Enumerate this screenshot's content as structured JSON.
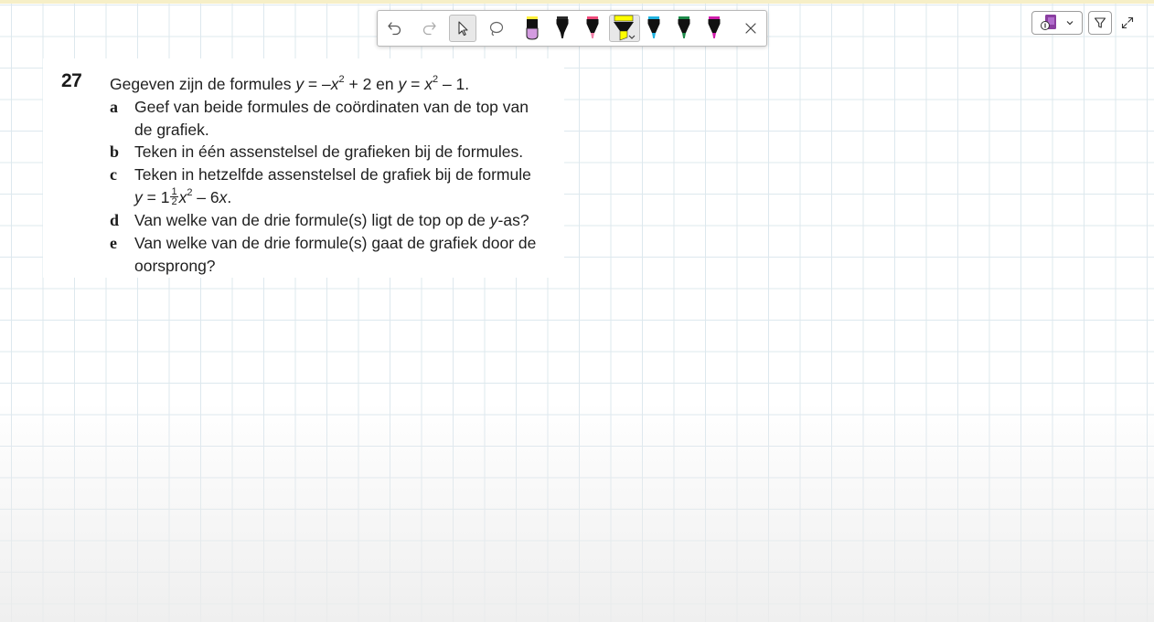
{
  "colors": {
    "grid_line": "#dde8ee",
    "top_strip": "#f6efc7",
    "highlighter_yellow": "#ffff00",
    "pen_pink": "#ef7ea6",
    "pen_lilac": "#d39be0",
    "pen_cyan": "#1fb2df",
    "pen_green": "#1d8a4a",
    "pen_magenta": "#d01dac",
    "app_accent": "#8a3ea0"
  },
  "toolbar": {
    "tools": [
      {
        "name": "undo",
        "icon": "undo-icon"
      },
      {
        "name": "redo",
        "icon": "redo-icon"
      },
      {
        "name": "select",
        "icon": "cursor-icon",
        "selected": true
      },
      {
        "name": "lasso",
        "icon": "lasso-icon"
      },
      {
        "name": "pen-lilac",
        "icon": "pen-icon"
      },
      {
        "name": "pen-black",
        "icon": "pen-icon"
      },
      {
        "name": "pen-pink",
        "icon": "pen-icon"
      },
      {
        "name": "highlighter-yellow",
        "icon": "highlighter-icon",
        "selected": true
      },
      {
        "name": "pen-cyan",
        "icon": "pen-icon"
      },
      {
        "name": "pen-green",
        "icon": "pen-icon"
      },
      {
        "name": "pen-magenta",
        "icon": "pen-icon"
      },
      {
        "name": "close",
        "icon": "close-icon"
      }
    ]
  },
  "top_right": {
    "app_icon": "onenote-class-notebook-icon",
    "dropdown_icon": "chevron-down-icon",
    "filter_icon": "funnel-icon",
    "expand_icon": "expand-icon"
  },
  "exercise": {
    "number": "27",
    "intro": {
      "text1": "Gegeven zijn de formules ",
      "f1_y": "y",
      "f1_eq": " = –",
      "f1_x": "x",
      "f1_exp": "2",
      "f1_rest": " + 2 en ",
      "f2_y": "y",
      "f2_eq": " = ",
      "f2_x": "x",
      "f2_exp": "2",
      "f2_rest": " – 1."
    },
    "a": {
      "letter": "a",
      "line1": "Geef van beide formules de coördinaten van de top van",
      "line2": "de grafiek."
    },
    "b": {
      "letter": "b",
      "line1": "Teken in één assenstelsel de grafieken bij de formules."
    },
    "c": {
      "letter": "c",
      "line1": "Teken in hetzelfde assenstelsel de grafiek bij de formule",
      "f_y": "y",
      "f_eq": " = 1",
      "f_num": "1",
      "f_den": "2",
      "f_x": "x",
      "f_exp": "2",
      "f_mid": " – 6",
      "f_x2": "x",
      "f_end": "."
    },
    "d": {
      "letter": "d",
      "text1": "Van welke van de drie formule(s) ligt de top op de ",
      "text_y": "y",
      "text2": "-as?"
    },
    "e": {
      "letter": "e",
      "line1": "Van welke van de drie formule(s) gaat de grafiek door de",
      "line2": "oorsprong?"
    }
  }
}
